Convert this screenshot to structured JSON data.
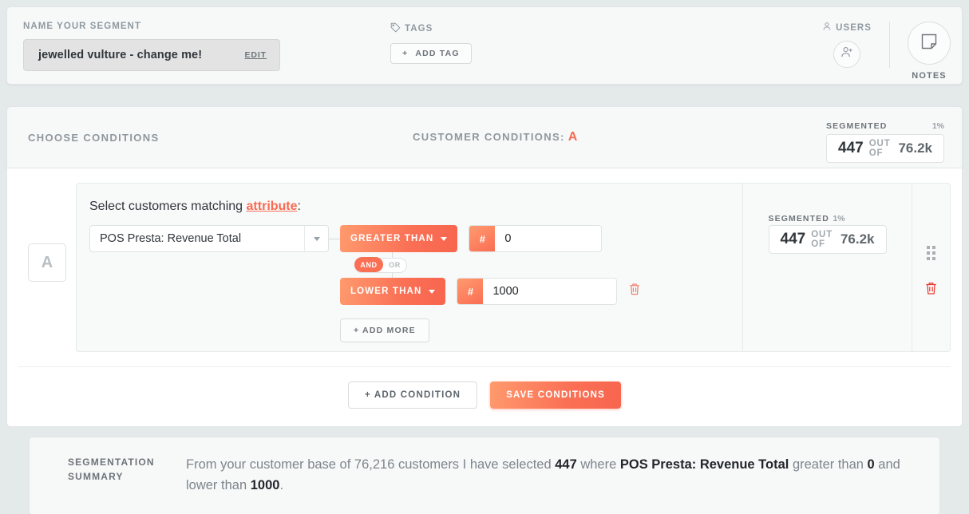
{
  "header": {
    "name_label": "NAME YOUR SEGMENT",
    "segment_name": "jewelled vulture - change me!",
    "edit_label": "EDIT",
    "tags_label": "TAGS",
    "add_tag_label": "ADD TAG",
    "add_tag_plus": "+",
    "users_label": "USERS",
    "notes_label": "NOTES"
  },
  "conditions": {
    "choose_label": "CHOOSE CONDITIONS",
    "customer_conditions_label": "CUSTOMER CONDITIONS:",
    "customer_conditions_letter": "A",
    "segmented": {
      "title": "SEGMENTED",
      "percent": "1%",
      "count": "447",
      "out_of_label": "OUT OF",
      "total": "76.2k"
    },
    "group_letter": "A",
    "select_prefix": "Select customers matching ",
    "select_link": "attribute",
    "select_suffix": ":",
    "attribute_value": "POS Presta: Revenue Total",
    "rules": [
      {
        "operator": "GREATER THAN",
        "prefix": "#",
        "value": "0"
      },
      {
        "operator": "LOWER THAN",
        "prefix": "#",
        "value": "1000"
      }
    ],
    "logic_on": "AND",
    "logic_off": "OR",
    "add_more_label": "+ ADD MORE",
    "panel_segmented": {
      "title": "SEGMENTED",
      "percent": "1%",
      "count": "447",
      "out_of_label": "OUT OF",
      "total": "76.2k"
    },
    "add_condition_label": "+ ADD CONDITION",
    "save_conditions_label": "SAVE CONDITIONS"
  },
  "summary": {
    "label_line1": "SEGMENTATION",
    "label_line2": "SUMMARY",
    "t1": "From your customer base of 76,216 customers I have selected ",
    "b1": "447",
    "t2": " where ",
    "b2": "POS Presta: Revenue Total",
    "t3": " greater than ",
    "b3": "0",
    "t4": " and lower than ",
    "b4": "1000",
    "t5": "."
  },
  "colors": {
    "accent": "#f96a52",
    "accent_light": "#ff9a6e",
    "page_bg": "#e4e9e9",
    "danger": "#e8392f"
  }
}
